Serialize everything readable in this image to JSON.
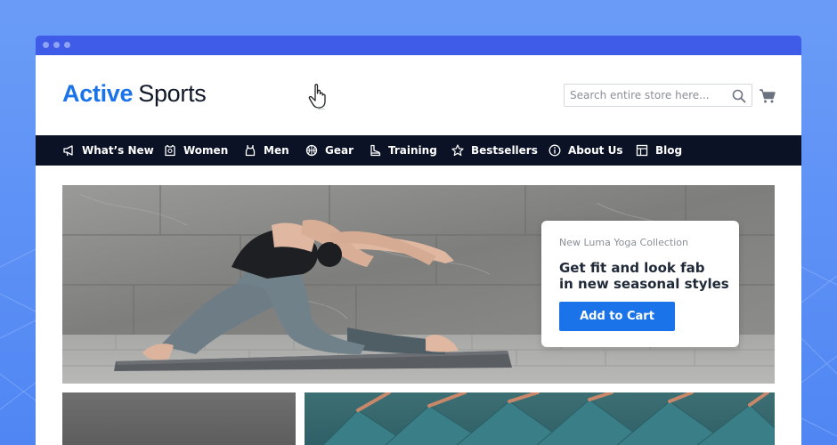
{
  "brand": {
    "name_part1": "Active",
    "name_part2": "Sports"
  },
  "search": {
    "placeholder": "Search entire store here..."
  },
  "nav": {
    "items": [
      {
        "label": "What’s New",
        "icon": "megaphone-icon"
      },
      {
        "label": "Women",
        "icon": "shirt-icon"
      },
      {
        "label": "Men",
        "icon": "tank-top-icon"
      },
      {
        "label": "Gear",
        "icon": "ball-icon"
      },
      {
        "label": "Training",
        "icon": "shoe-icon"
      },
      {
        "label": "Bestsellers",
        "icon": "star-icon"
      },
      {
        "label": "About Us",
        "icon": "info-icon"
      },
      {
        "label": "Blog",
        "icon": "blog-icon"
      }
    ]
  },
  "hero": {
    "eyebrow": "New Luma Yoga Collection",
    "headline_line1": "Get fit and look fab",
    "headline_line2": "in new seasonal styles",
    "cta_label": "Add to Cart"
  },
  "colors": {
    "accent": "#1a73e8",
    "nav_bg": "#0b1226",
    "titlebar": "#3e5ce8",
    "page_bg": "#5b8ff5"
  }
}
